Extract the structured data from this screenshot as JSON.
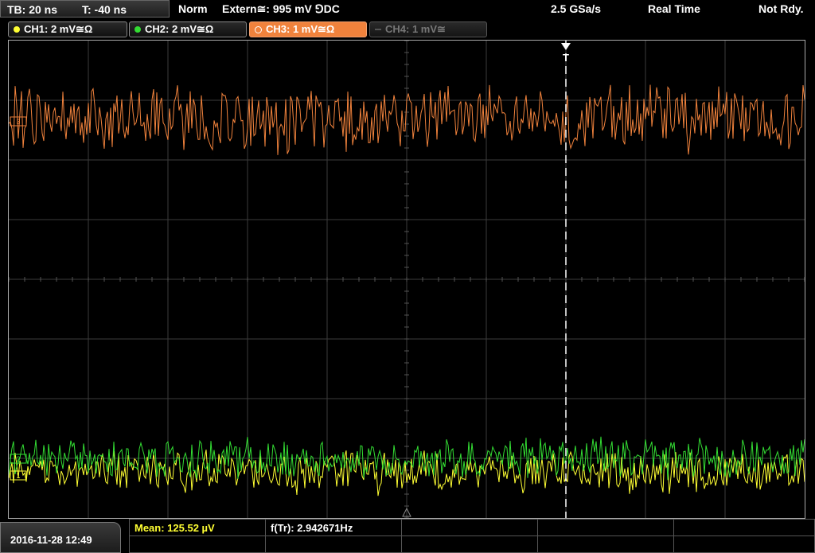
{
  "timebase": {
    "tb": "TB: 20 ns",
    "t": "T: -40 ns"
  },
  "status": {
    "mode": "Norm",
    "trigger": "Extern≅: 995 mV ⅁DC",
    "sample_rate": "2.5 GSa/s",
    "acq": "Real Time",
    "ready": "Not Rdy."
  },
  "channels": [
    {
      "label": "CH1: 2 mV≅Ω",
      "color": "#ffff33",
      "state": "on"
    },
    {
      "label": "CH2: 2 mV≅Ω",
      "color": "#33dd33",
      "state": "on"
    },
    {
      "label": "CH3: 1 mV≅Ω",
      "color": "#f0823c",
      "state": "active"
    },
    {
      "label": "CH4: 1 mV≅",
      "color": "#666666",
      "state": "off"
    }
  ],
  "markers": {
    "trigger": "T",
    "ch3": "3",
    "ch2": "2",
    "ch1": "1"
  },
  "footer": {
    "datetime": "2016-11-28 12:49"
  },
  "measurements": {
    "mean": "Mean: 125.52 µV",
    "freq": "f(Tr): 2.942671Hz"
  },
  "colors": {
    "ch1": "#ffff33",
    "ch2": "#33dd33",
    "ch3": "#f0823c",
    "grid": "#444444",
    "mean_text": "#ffff33"
  }
}
